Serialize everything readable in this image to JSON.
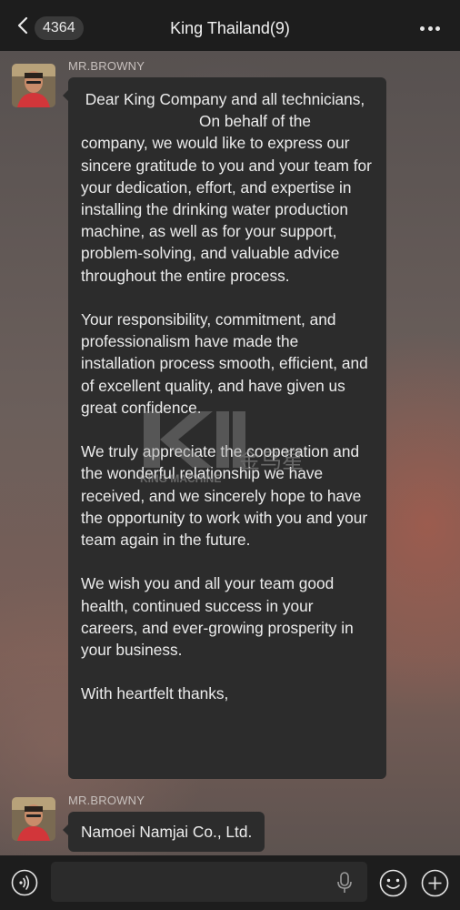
{
  "header": {
    "unread_count": "4364",
    "title": "King Thailand(9)"
  },
  "messages": [
    {
      "sender": "MR.BROWNY",
      "paragraphs": [
        "Your responsibility, commitment, and professionalism have made the installation process smooth, efficient, and of excellent quality, and have given us great confidence.",
        "We truly appreciate the cooperation and the wonderful relationship we have received, and we sincerely hope to have the opportunity to work with you and your team again in the future.",
        "We wish you and all your team good health, continued success in your careers, and ever-growing prosperity in your business.",
        "With heartfelt thanks,"
      ],
      "intro_start": " Dear King Company and all technicians,",
      "intro_rest": "On behalf of the company, we would like to express our sincere gratitude to you and your team for your dedication, effort, and expertise in installing the drinking water production machine, as well as for your support, problem-solving, and valuable advice throughout the entire process."
    },
    {
      "sender": "MR.BROWNY",
      "text": "Namoei Namjai Co., Ltd."
    }
  ],
  "watermark": {
    "brand": "KING MACHINE",
    "chinese": "金鸟星"
  },
  "input": {
    "value": ""
  },
  "colors": {
    "header_bg": "#1d1d1d",
    "bubble_bg": "#2c2c2c",
    "text": "#ececec"
  }
}
